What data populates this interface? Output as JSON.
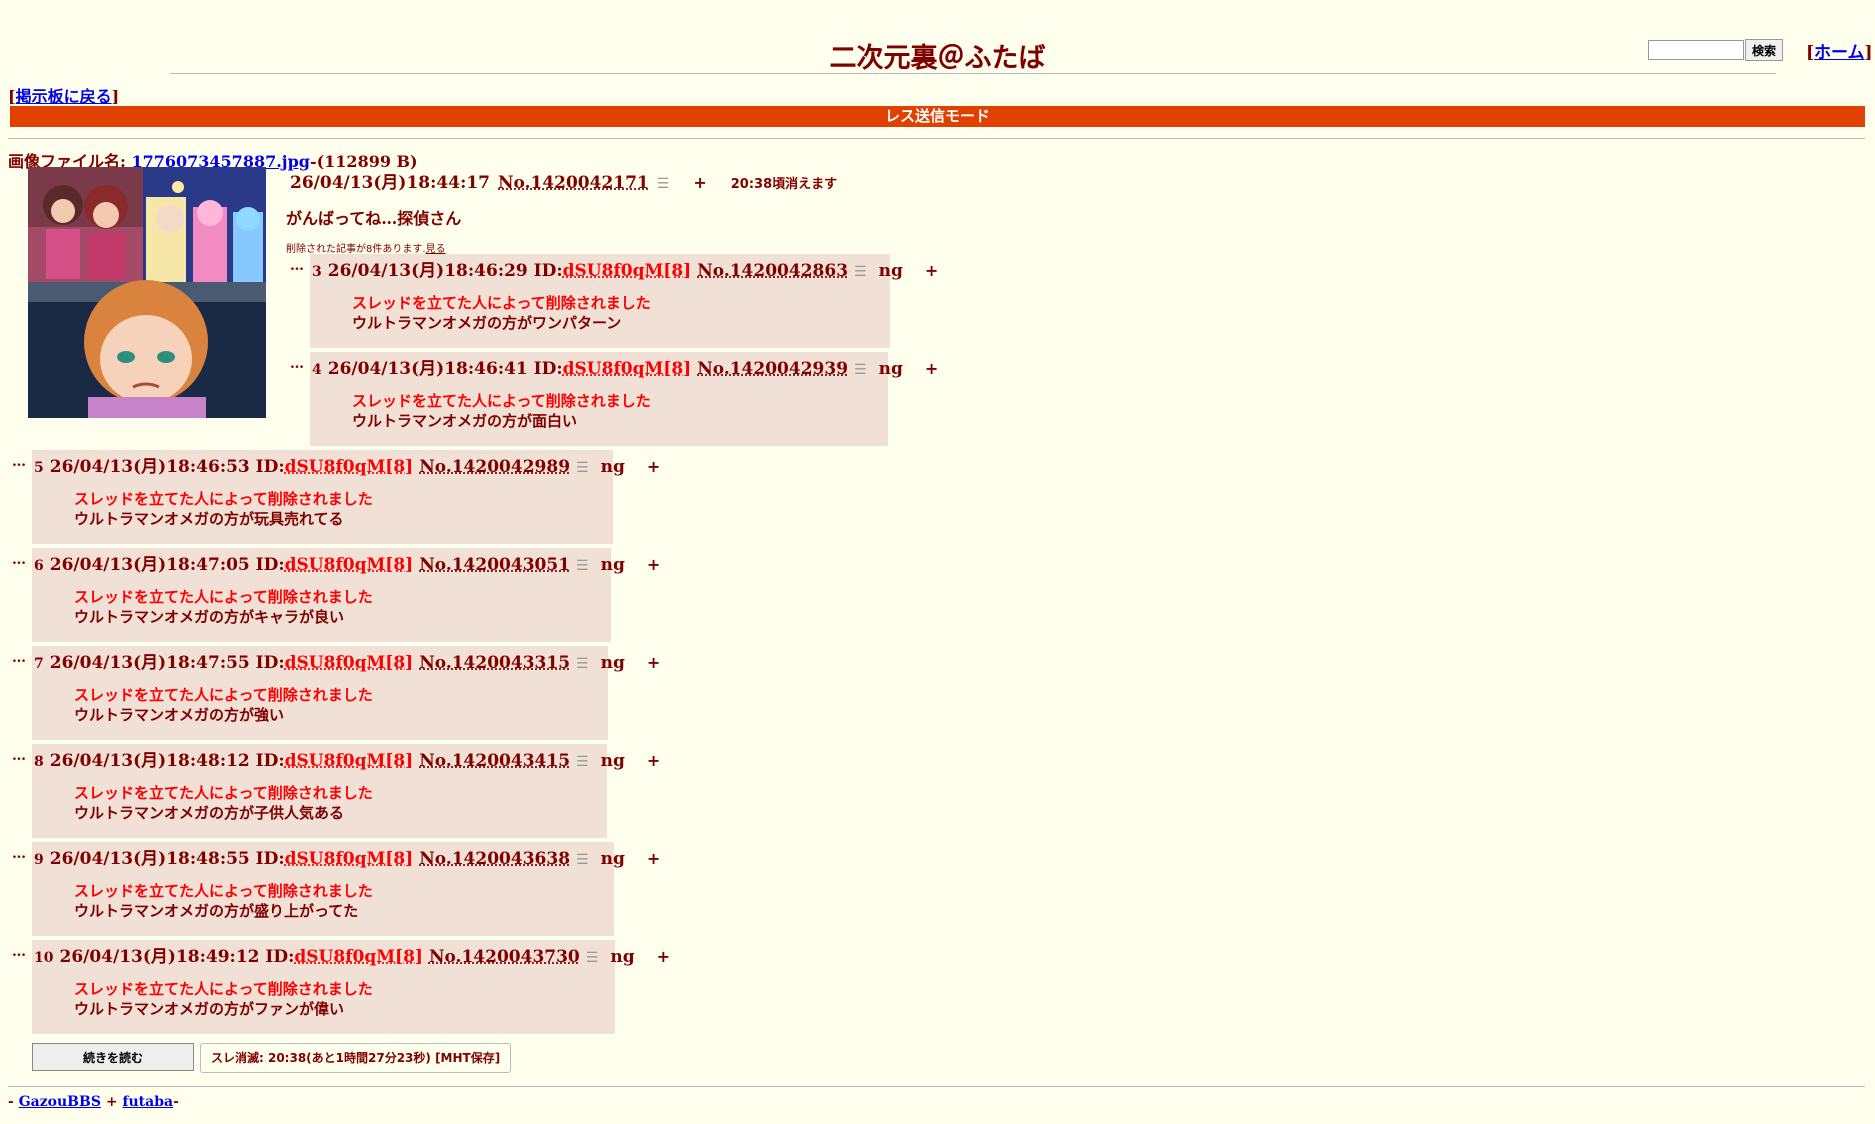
{
  "header": {
    "title": "二次元裏＠ふたば",
    "search_button": "検索",
    "home_link": "ホーム",
    "back_link": "掲示板に戻る",
    "mode_bar": "レス送信モード"
  },
  "op": {
    "file_label": "画像ファイル名: ",
    "file_name": "1776073457887.jpg",
    "file_size": "-(112899 B)",
    "datetime": "26/04/13(月)18:44:17",
    "no": "No.1420042171",
    "expire": "20:38頃消えます",
    "body": "がんばってね…探偵さん",
    "deleted_note": "削除された記事が8件あります.",
    "deleted_show": "見る"
  },
  "reply_labels": {
    "dots": "…",
    "menu_icon": "☰",
    "ng": "ng",
    "plus": "+",
    "deleted_by_op": "スレッドを立てた人によって削除されました"
  },
  "replies": [
    {
      "num": "3",
      "datetime": "26/04/13(月)18:46:29",
      "id_label": "ID:",
      "id": "dSU8f0qM[8]",
      "no": "No.1420042863",
      "text": "ウルトラマンオメガの方がワンパターン"
    },
    {
      "num": "4",
      "datetime": "26/04/13(月)18:46:41",
      "id_label": "ID:",
      "id": "dSU8f0qM[8]",
      "no": "No.1420042939",
      "text": "ウルトラマンオメガの方が面白い"
    },
    {
      "num": "5",
      "datetime": "26/04/13(月)18:46:53",
      "id_label": "ID:",
      "id": "dSU8f0qM[8]",
      "no": "No.1420042989",
      "text": "ウルトラマンオメガの方が玩具売れてる"
    },
    {
      "num": "6",
      "datetime": "26/04/13(月)18:47:05",
      "id_label": "ID:",
      "id": "dSU8f0qM[8]",
      "no": "No.1420043051",
      "text": "ウルトラマンオメガの方がキャラが良い"
    },
    {
      "num": "7",
      "datetime": "26/04/13(月)18:47:55",
      "id_label": "ID:",
      "id": "dSU8f0qM[8]",
      "no": "No.1420043315",
      "text": "ウルトラマンオメガの方が強い"
    },
    {
      "num": "8",
      "datetime": "26/04/13(月)18:48:12",
      "id_label": "ID:",
      "id": "dSU8f0qM[8]",
      "no": "No.1420043415",
      "text": "ウルトラマンオメガの方が子供人気ある"
    },
    {
      "num": "9",
      "datetime": "26/04/13(月)18:48:55",
      "id_label": "ID:",
      "id": "dSU8f0qM[8]",
      "no": "No.1420043638",
      "text": "ウルトラマンオメガの方が盛り上がってた"
    },
    {
      "num": "10",
      "datetime": "26/04/13(月)18:49:12",
      "id_label": "ID:",
      "id": "dSU8f0qM[8]",
      "no": "No.1420043730",
      "text": "ウルトラマンオメガの方がファンが偉い"
    }
  ],
  "footer_actions": {
    "continue_button": "続きを読む",
    "status": "スレ消滅: 20:38(あと1時間27分23秒) [MHT保存]"
  },
  "footer": {
    "prefix": "- ",
    "link1": "GazouBBS",
    "sep": " + ",
    "link2": "futaba",
    "suffix": "-"
  },
  "colors": {
    "background": "#ffffee",
    "text": "#800000",
    "reply_bg": "#f0e0d6",
    "mode_bar": "#e04000",
    "id_red": "#ff0000",
    "link": "#0000ee"
  }
}
